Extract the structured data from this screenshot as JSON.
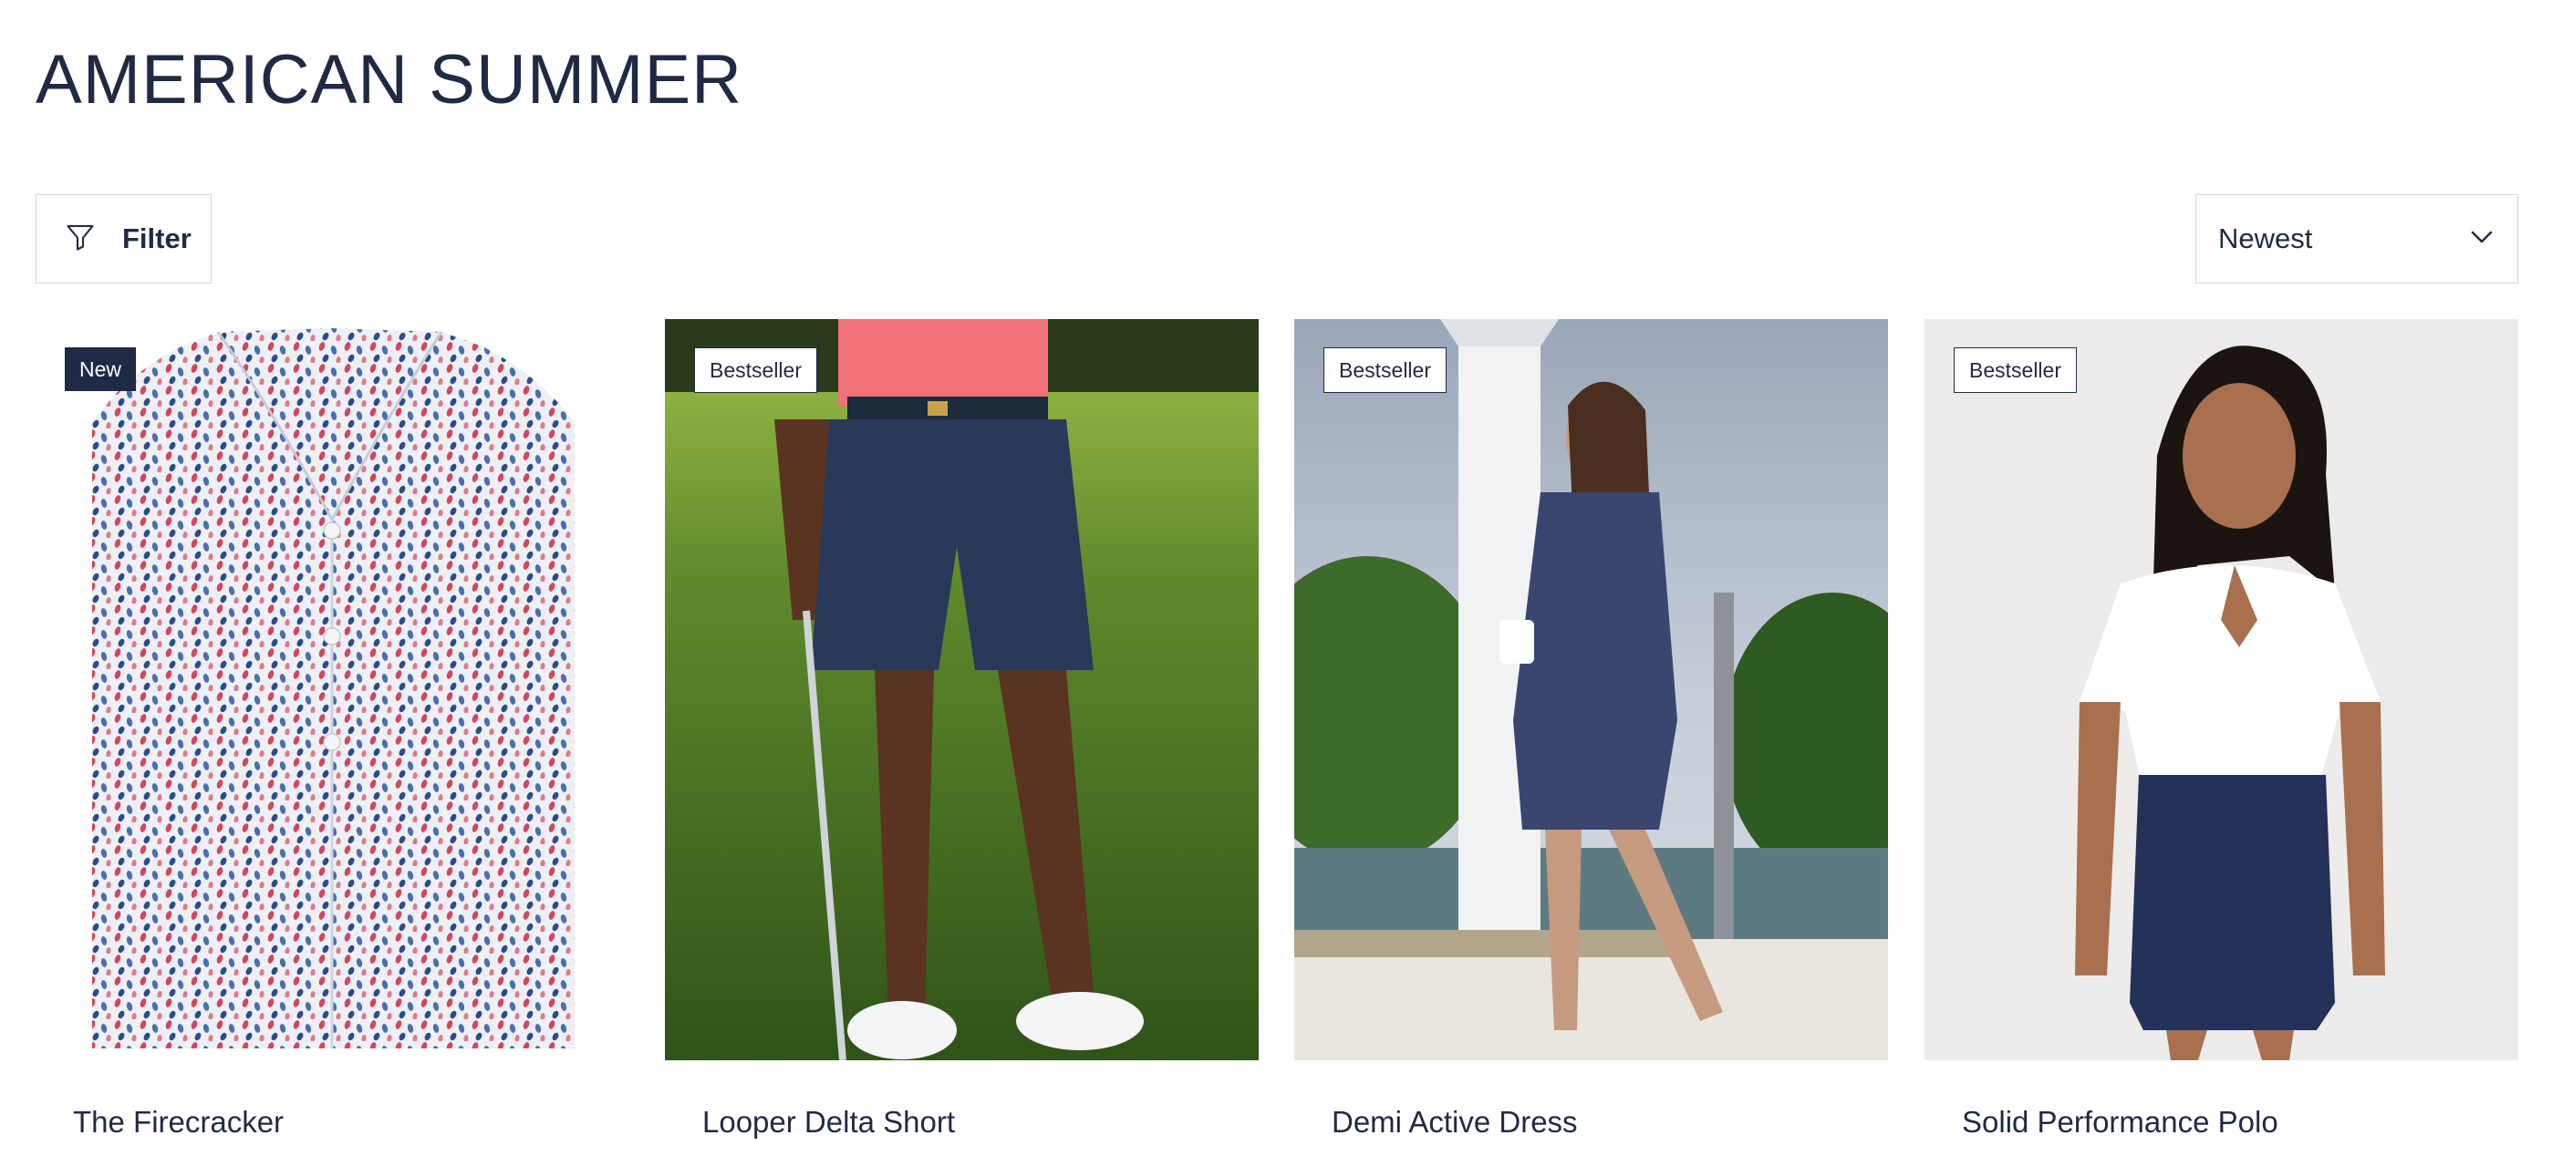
{
  "page": {
    "title": "AMERICAN SUMMER"
  },
  "toolbar": {
    "filter_label": "Filter",
    "filter_icon": "funnel-icon",
    "sort_value": "Newest",
    "sort_icon": "chevron-down-icon"
  },
  "colors": {
    "navy": "#1f2a44",
    "border": "#d4d7de"
  },
  "products": [
    {
      "name": "The Firecracker",
      "badge": "New"
    },
    {
      "name": "Looper Delta Short",
      "badge": "Bestseller"
    },
    {
      "name": "Demi Active Dress",
      "badge": "Bestseller"
    },
    {
      "name": "Solid Performance Polo",
      "badge": "Bestseller"
    }
  ]
}
